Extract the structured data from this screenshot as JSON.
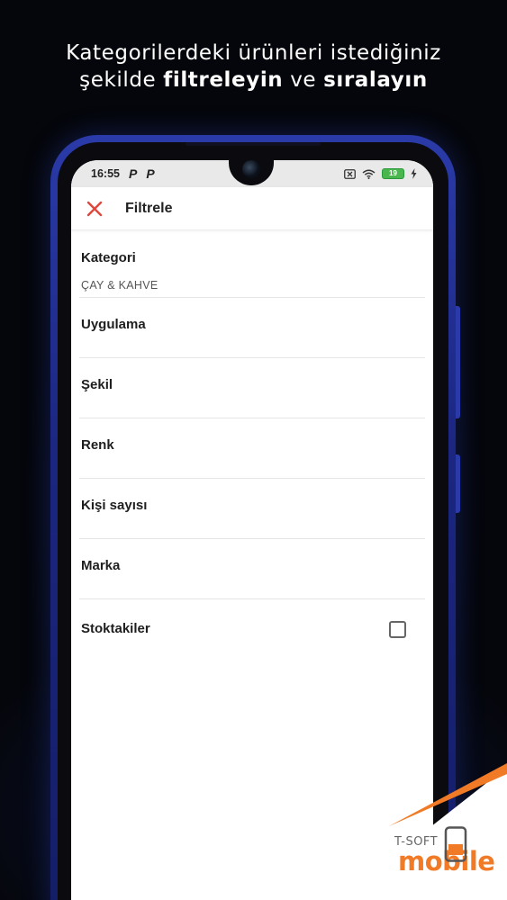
{
  "headline": {
    "line1": "Kategorilerdeki ürünleri istediğiniz",
    "line2_pre": "şekilde ",
    "line2_bold1": "filtreleyin",
    "line2_mid": " ve ",
    "line2_bold2": "sıralayın"
  },
  "status_bar": {
    "time": "16:55",
    "left_icons": [
      "P",
      "P"
    ],
    "battery": "19",
    "icons": [
      "sim-off-icon",
      "wifi-icon",
      "battery-icon",
      "charging-icon"
    ]
  },
  "app_bar": {
    "title": "Filtrele",
    "close_icon": "close-icon",
    "accent_color": "#e0463c"
  },
  "filters": {
    "category": {
      "label": "Kategori",
      "value": "ÇAY & KAHVE"
    },
    "items": [
      {
        "label": "Uygulama"
      },
      {
        "label": "Şekil"
      },
      {
        "label": "Renk"
      },
      {
        "label": "Kişi sayısı"
      },
      {
        "label": "Marka"
      }
    ],
    "in_stock": {
      "label": "Stoktakiler",
      "checked": false
    }
  },
  "branding": {
    "tsoft": "T-SOFT",
    "mobile": "mobile",
    "brand_color": "#f07a26"
  }
}
